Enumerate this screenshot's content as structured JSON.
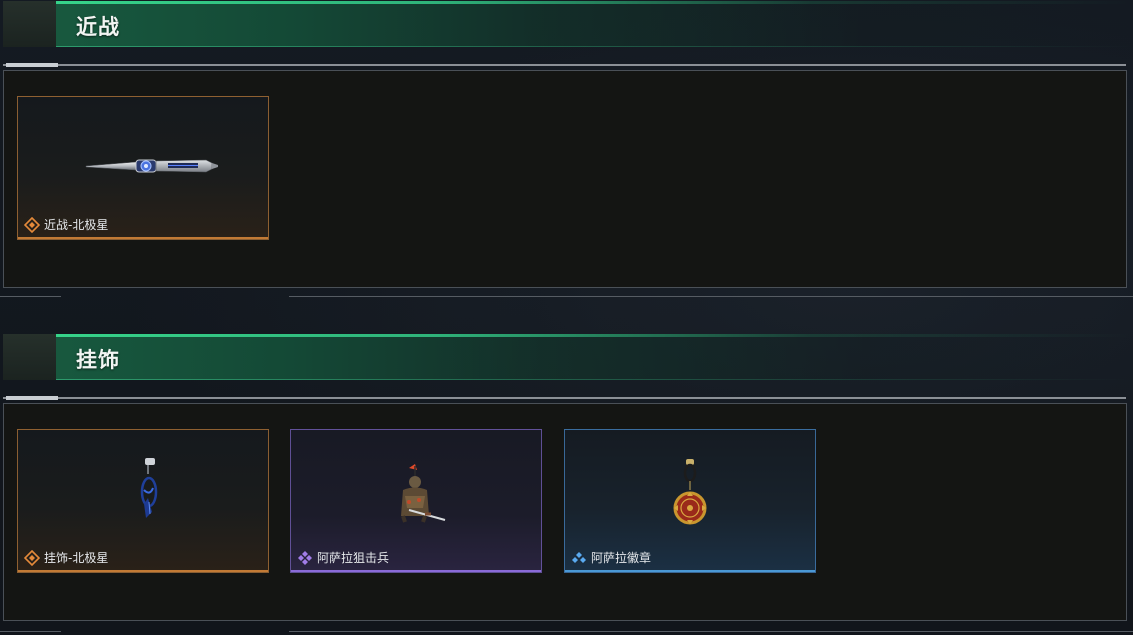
{
  "sections": [
    {
      "title": "近战",
      "items": [
        {
          "name": "近战-北极星",
          "rarity": "orange",
          "rarity_icon": "orange-diamond-icon",
          "art": "knife-image"
        }
      ]
    },
    {
      "title": "挂饰",
      "items": [
        {
          "name": "挂饰-北极星",
          "rarity": "orange",
          "rarity_icon": "orange-diamond-icon",
          "art": "blue-charm-image"
        },
        {
          "name": "阿萨拉狙击兵",
          "rarity": "purple",
          "rarity_icon": "purple-diamond-icon",
          "art": "sniper-figure-image"
        },
        {
          "name": "阿萨拉徽章",
          "rarity": "blue",
          "rarity_icon": "blue-diamond-icon",
          "art": "medal-image"
        }
      ]
    }
  ],
  "colors": {
    "orange": "#e58a3a",
    "purple": "#a17ce8",
    "blue": "#5aaaf0",
    "header_green": "#2fb37a"
  }
}
